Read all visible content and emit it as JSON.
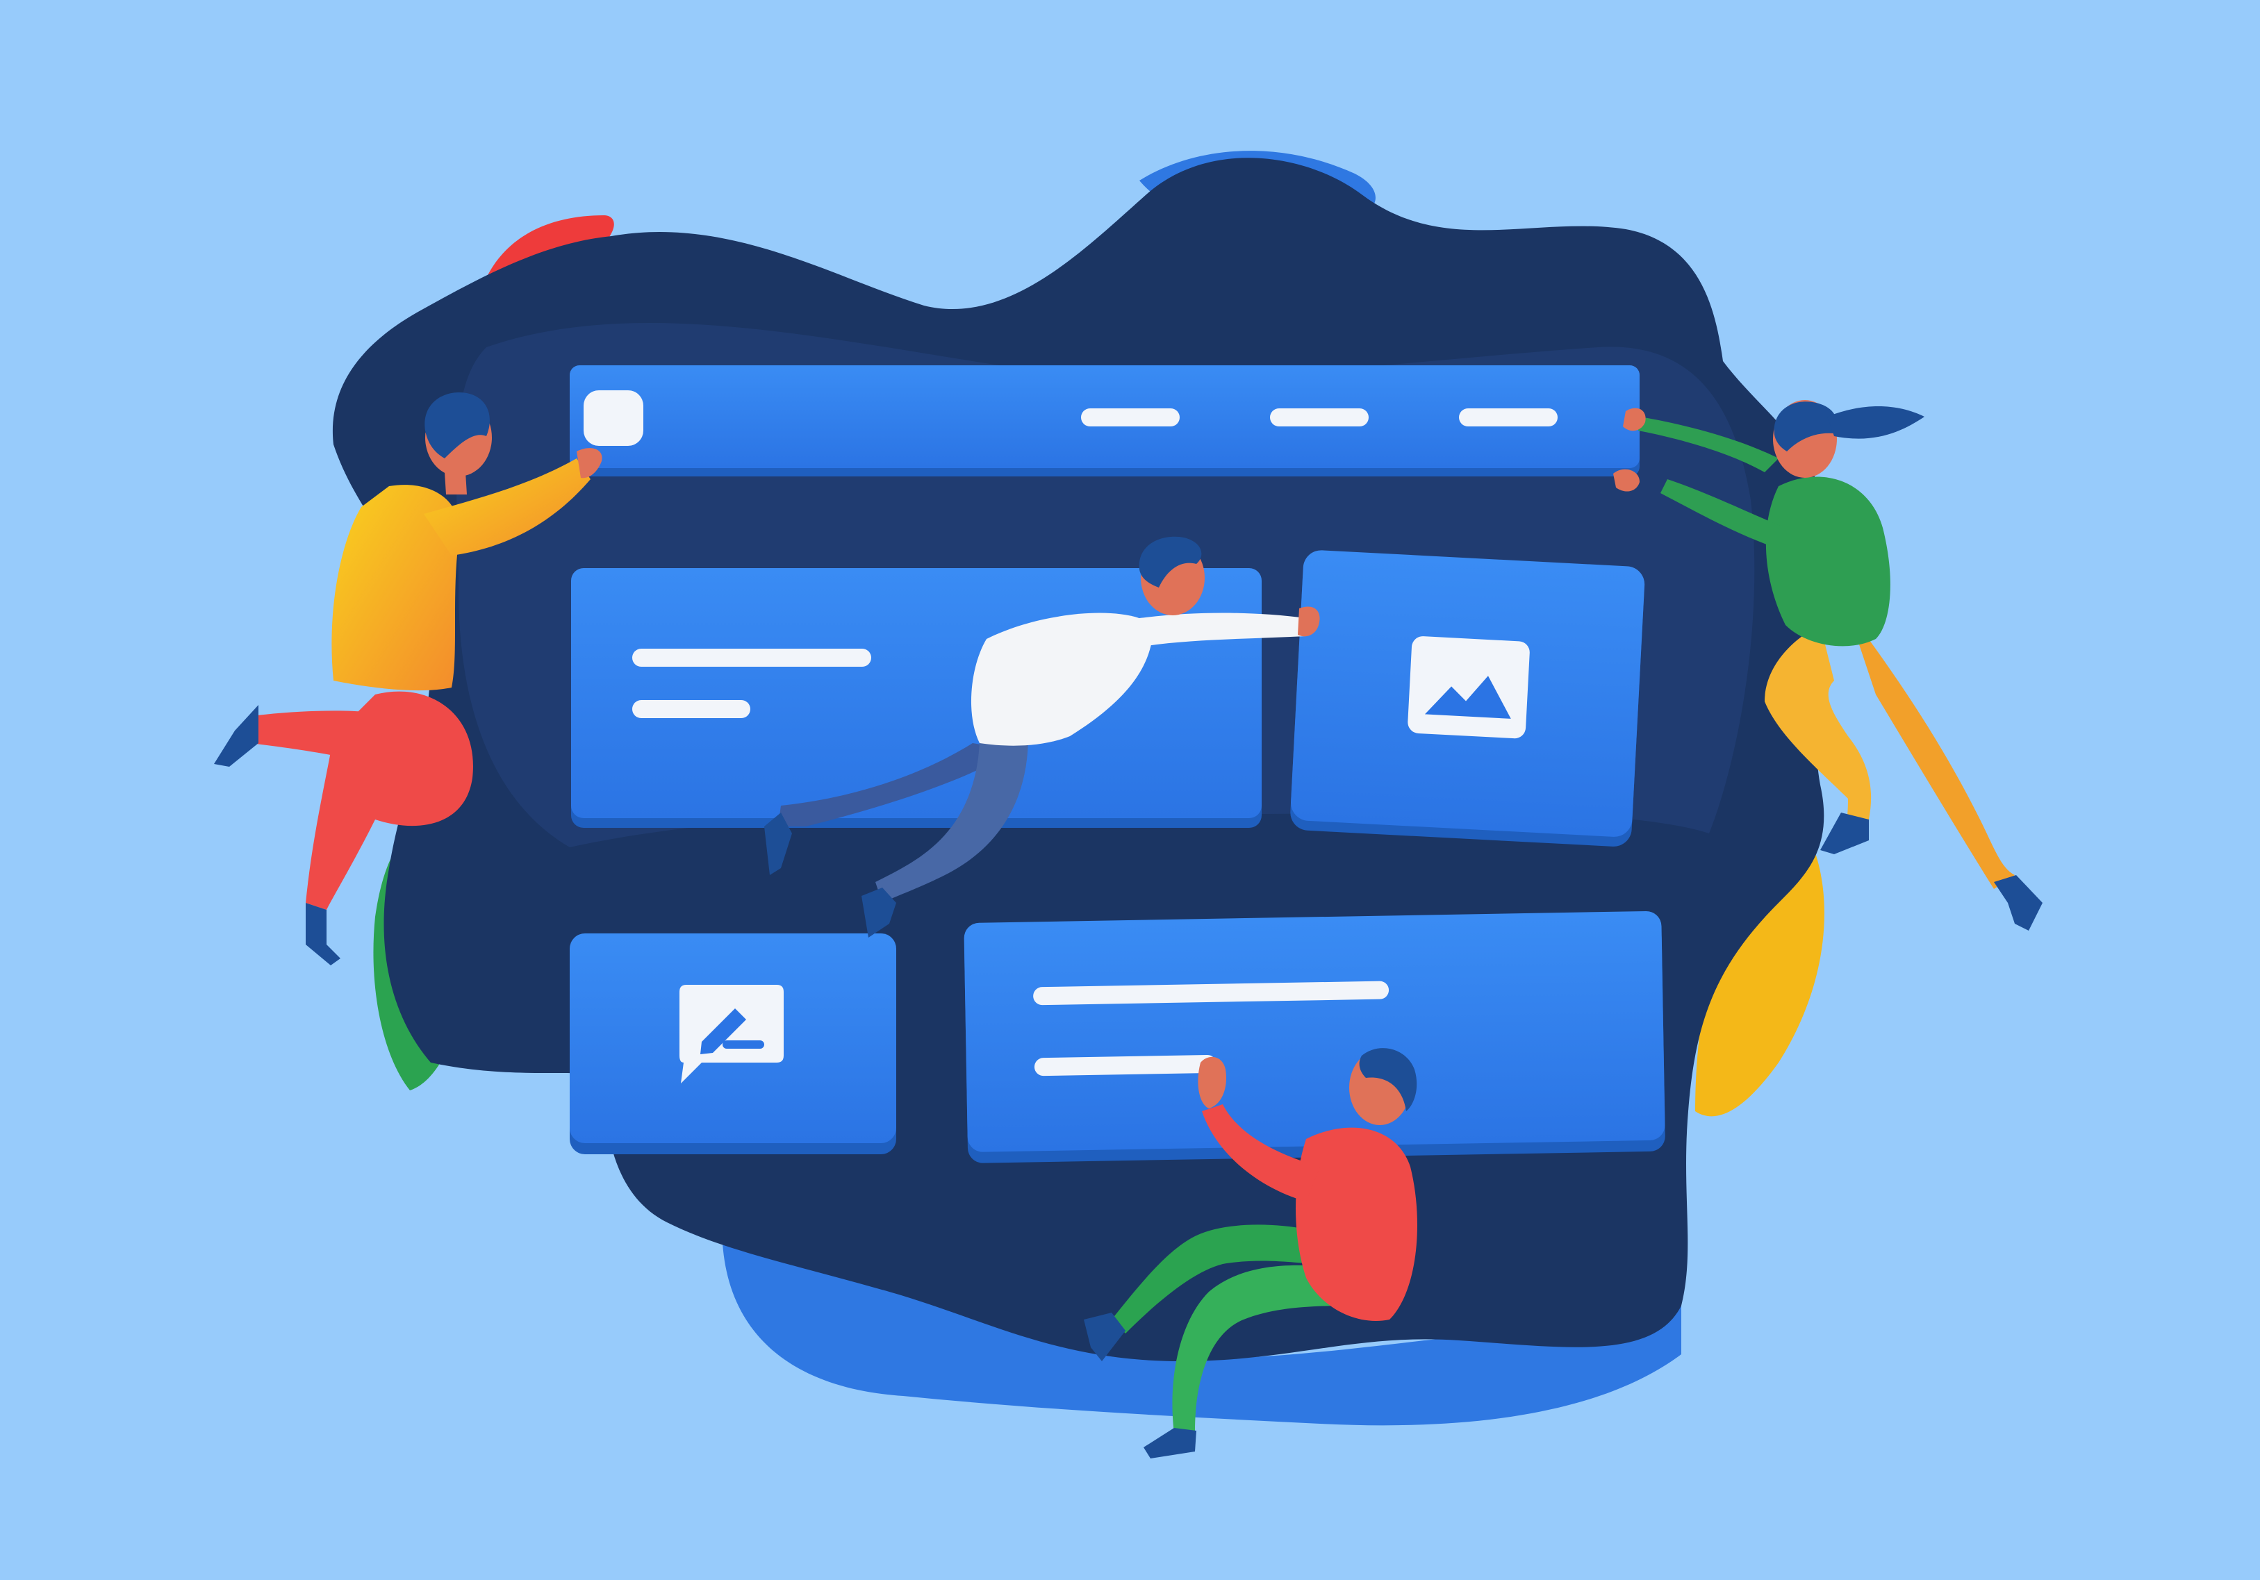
{
  "colors": {
    "background": "#97CBFB",
    "blob_dark": "#1B3563",
    "blob_mid": "#233F73",
    "blob_bright": "#2F78E2",
    "accent_red": "#EE3B3B",
    "accent_green": "#2BA350",
    "accent_yellow": "#F4B818",
    "panel_blue": "#3182EF",
    "panel_edge": "#1F5FBF",
    "bar_white": "#F2F5FA",
    "skin": "#E07258",
    "hair": "#1D4E96"
  },
  "header_bar": {
    "nav_item_count": 3
  },
  "icons": {
    "header_logo": "square-logo-icon",
    "image_card": "image-icon",
    "comment_card": "edit-comment-icon"
  }
}
